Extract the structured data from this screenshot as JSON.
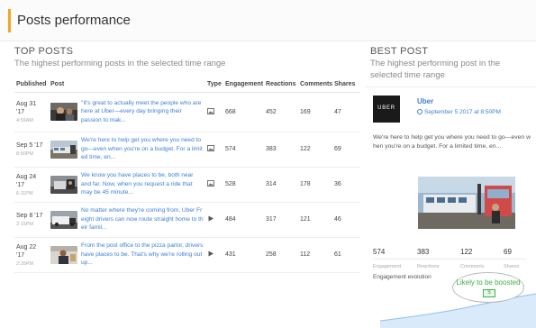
{
  "header": {
    "title": "Posts performance"
  },
  "top_posts": {
    "title": "TOP POSTS",
    "subtitle": "The highest performing posts in the selected time range",
    "columns": {
      "published": "Published",
      "post": "Post",
      "type": "Type",
      "engagement": "Engagement",
      "reactions": "Reactions",
      "comments": "Comments",
      "shares": "Shares"
    },
    "rows": [
      {
        "date": "Aug 31\n'17",
        "time": "4:59AM",
        "text": "\"It's great to actually meet the people who are here at Uber—every day bringing their passion to mak...",
        "type": "photo",
        "engagement": "668",
        "reactions": "452",
        "comments": "169",
        "shares": "47"
      },
      {
        "date": "Sep 5 '17",
        "time": "8:50PM",
        "text": "We're here to help get you where you need to go—even when you're on a budget. For a limit ed time, en...",
        "type": "photo",
        "engagement": "574",
        "reactions": "383",
        "comments": "122",
        "shares": "69"
      },
      {
        "date": "Aug 24\n'17",
        "time": "6:11PM",
        "text": "We know you have places to be, both near and far. Now, when you request a ride that may be 45 minute...",
        "type": "photo",
        "engagement": "528",
        "reactions": "314",
        "comments": "178",
        "shares": "36"
      },
      {
        "date": "Sep 8 '17",
        "time": "2:15PM",
        "text": "No matter where they're coming from, Uber Fr eight drivers can now route straight home to th eir famil...",
        "type": "video",
        "engagement": "484",
        "reactions": "317",
        "comments": "121",
        "shares": "46"
      },
      {
        "date": "Aug 22\n'17",
        "time": "2:26PM",
        "text": "From the post office to the pizza parlor, drivers have places to be. That's why we're rolling out up...",
        "type": "video",
        "engagement": "431",
        "reactions": "258",
        "comments": "112",
        "shares": "61"
      }
    ]
  },
  "best_post": {
    "title": "BEST POST",
    "subtitle": "The highest performing post in the selected time range",
    "logo_text": "UBER",
    "page_name": "Uber",
    "timestamp": "September 5 2017 at 8:50PM",
    "text": "We're here to help get you where you need to go—even w hen you're on a budget. For a limited time, en...",
    "stats": [
      {
        "value": "574",
        "label": "Engagement"
      },
      {
        "value": "383",
        "label": "Reactions"
      },
      {
        "value": "122",
        "label": "Comments"
      },
      {
        "value": "69",
        "label": "Shares"
      }
    ],
    "evolution_label": "Engagement evolution",
    "boost_text": "Likely to be boosted",
    "money_icon": "$",
    "accent_color": "#3d7fd6",
    "boost_color": "#41b04b"
  }
}
